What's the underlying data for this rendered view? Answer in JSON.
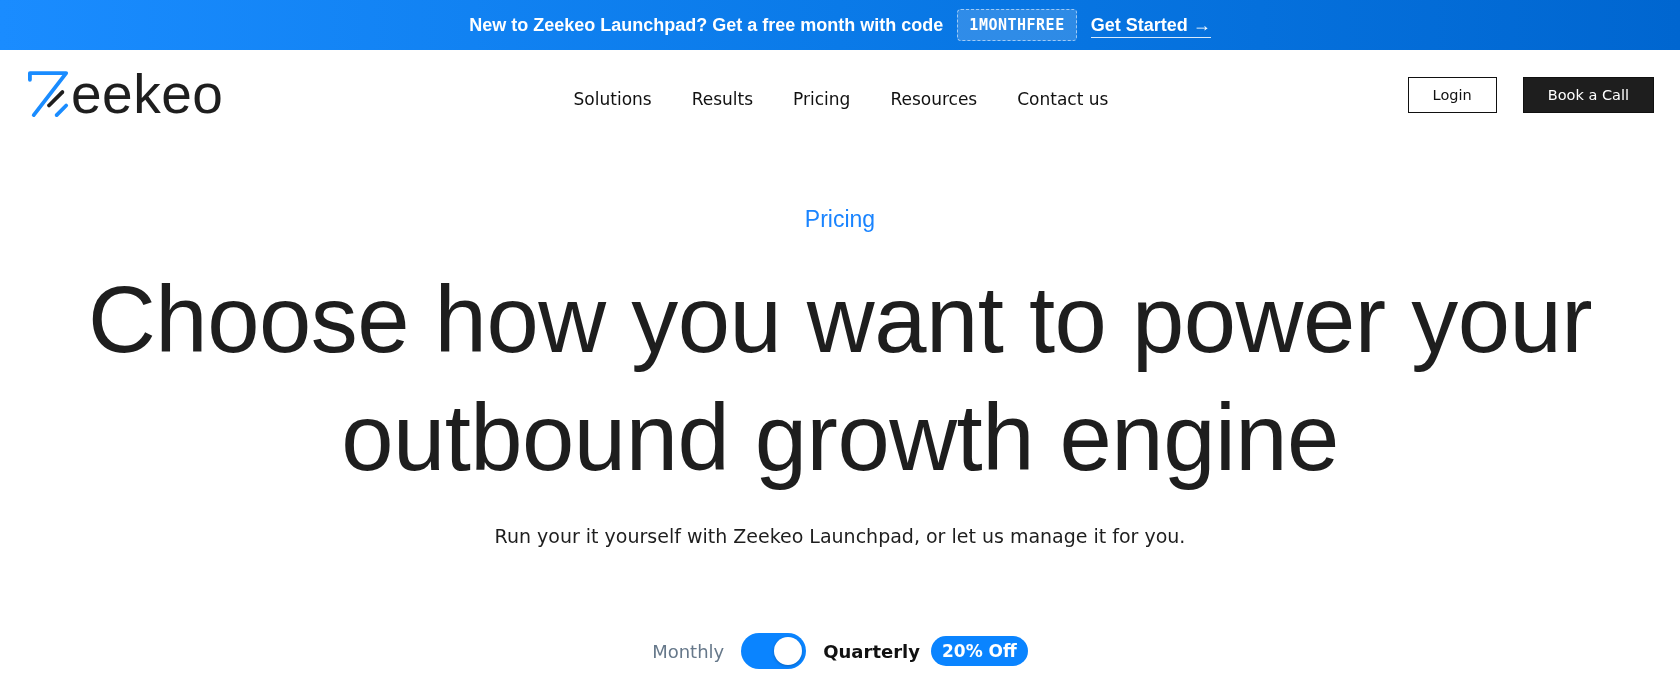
{
  "banner": {
    "text": "New to Zeekeo Launchpad? Get a free month with code",
    "code": "1MONTHFREE",
    "link": "Get Started →"
  },
  "header": {
    "logo": {
      "text": "eekeo"
    },
    "nav": [
      {
        "label": "Solutions"
      },
      {
        "label": "Results"
      },
      {
        "label": "Pricing"
      },
      {
        "label": "Resources"
      },
      {
        "label": "Contact us"
      }
    ],
    "buttons": [
      {
        "label": "Login",
        "kind": "outline"
      },
      {
        "label": "Book a Call",
        "kind": "solid"
      }
    ]
  },
  "hero": {
    "eyebrow": "Pricing",
    "heading": "Choose how you want to power your outbound growth engine",
    "subtitle": "Run your it yourself with Zeekeo Launchpad, or let us manage it for you."
  },
  "billing_toggle": {
    "options": [
      {
        "label": "Monthly",
        "selected": false
      },
      {
        "label": "Quarterly",
        "selected": true
      }
    ],
    "on": true,
    "badge": "20% Off"
  }
}
